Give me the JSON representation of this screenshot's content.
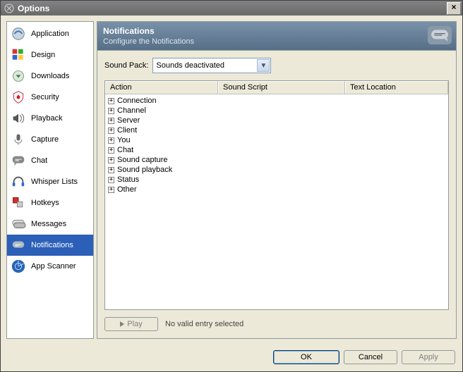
{
  "window": {
    "title": "Options",
    "close_glyph": "×"
  },
  "sidebar": {
    "items": [
      {
        "label": "Application"
      },
      {
        "label": "Design"
      },
      {
        "label": "Downloads"
      },
      {
        "label": "Security"
      },
      {
        "label": "Playback"
      },
      {
        "label": "Capture"
      },
      {
        "label": "Chat"
      },
      {
        "label": "Whisper Lists"
      },
      {
        "label": "Hotkeys"
      },
      {
        "label": "Messages"
      },
      {
        "label": "Notifications"
      },
      {
        "label": "App Scanner"
      }
    ],
    "selected_index": 10
  },
  "header": {
    "title": "Notifications",
    "subtitle": "Configure the Notifications"
  },
  "sound_pack": {
    "label": "Sound Pack:",
    "value": "Sounds deactivated"
  },
  "listview": {
    "columns": [
      "Action",
      "Sound Script",
      "Text Location"
    ],
    "rows": [
      {
        "label": "Connection"
      },
      {
        "label": "Channel"
      },
      {
        "label": "Server"
      },
      {
        "label": "Client"
      },
      {
        "label": "You"
      },
      {
        "label": "Chat"
      },
      {
        "label": "Sound capture"
      },
      {
        "label": "Sound playback"
      },
      {
        "label": "Status"
      },
      {
        "label": "Other"
      }
    ]
  },
  "play": {
    "label": "Play",
    "status": "No valid entry selected"
  },
  "buttons": {
    "ok": "OK",
    "cancel": "Cancel",
    "apply": "Apply"
  }
}
